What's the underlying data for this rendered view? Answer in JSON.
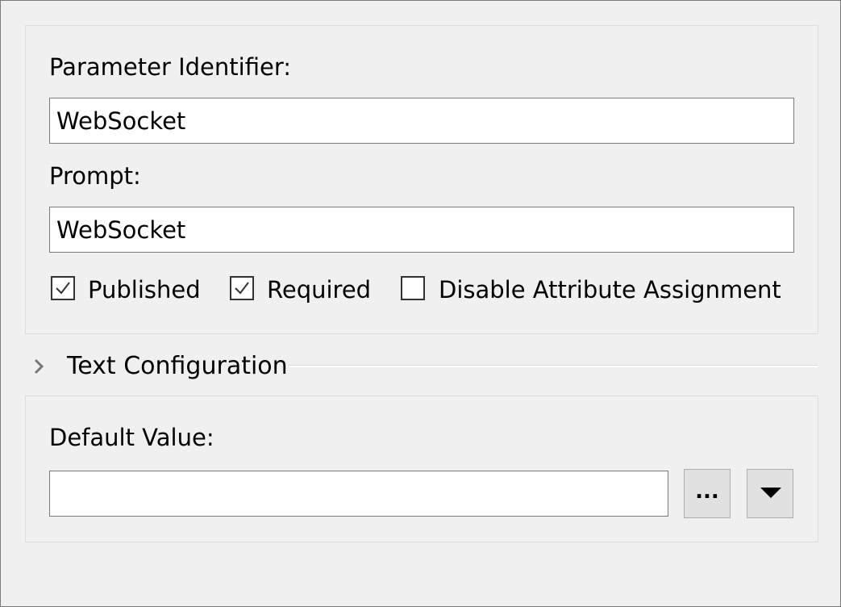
{
  "identifier": {
    "label": "Parameter Identifier:",
    "value": "WebSocket"
  },
  "prompt": {
    "label": "Prompt:",
    "value": "WebSocket"
  },
  "options": {
    "published": {
      "label": "Published",
      "checked": true
    },
    "required": {
      "label": "Required",
      "checked": true
    },
    "disable_attr": {
      "label": "Disable Attribute Assignment",
      "checked": false
    }
  },
  "text_config": {
    "title": "Text Configuration",
    "icon": "chevron-right-icon"
  },
  "default_value": {
    "label": "Default Value:",
    "value": "",
    "ellipsis_label": "...",
    "dropdown_icon": "triangle-down-icon"
  },
  "colors": {
    "background": "#f0f0f0",
    "input_border": "#7a7a7a",
    "group_border": "#dcdcdc",
    "button_face": "#e1e1e1"
  }
}
